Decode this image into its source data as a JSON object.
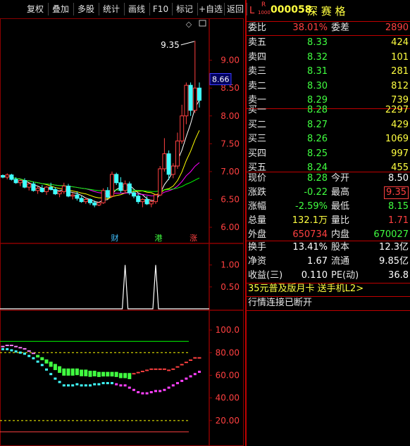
{
  "toolbar": {
    "buttons": [
      "复权",
      "叠加",
      "多股",
      "统计",
      "画线",
      "F10",
      "标记",
      "+自选",
      "返回"
    ]
  },
  "header": {
    "lr_top": "L",
    "lr_r": "R",
    "lr_sub": "1000",
    "code": "000058",
    "name": "深 赛 格"
  },
  "weibi": {
    "label1": "委比",
    "value1": "38.01%",
    "label2": "委差",
    "value2": "2890"
  },
  "sell": [
    {
      "label": "卖五",
      "price": "8.33",
      "vol": "424"
    },
    {
      "label": "卖四",
      "price": "8.32",
      "vol": "101"
    },
    {
      "label": "卖三",
      "price": "8.31",
      "vol": "281"
    },
    {
      "label": "卖二",
      "price": "8.30",
      "vol": "812"
    },
    {
      "label": "卖一",
      "price": "8.29",
      "vol": "739"
    }
  ],
  "buy": [
    {
      "label": "买一",
      "price": "8.28",
      "vol": "2297"
    },
    {
      "label": "买二",
      "price": "8.27",
      "vol": "429"
    },
    {
      "label": "买三",
      "price": "8.26",
      "vol": "1069"
    },
    {
      "label": "买四",
      "price": "8.25",
      "vol": "997"
    },
    {
      "label": "买五",
      "price": "8.24",
      "vol": "455"
    }
  ],
  "quote": [
    {
      "l1": "现价",
      "v1": "8.28",
      "c1": "grn",
      "l2": "今开",
      "v2": "8.50",
      "c2": "wht"
    },
    {
      "l1": "涨跌",
      "v1": "-0.22",
      "c1": "grn",
      "l2": "最高",
      "v2": "9.35",
      "c2": "red"
    },
    {
      "l1": "涨幅",
      "v1": "-2.59%",
      "c1": "grn",
      "l2": "最低",
      "v2": "8.15",
      "c2": "grn"
    },
    {
      "l1": "总量",
      "v1": "132.1万",
      "c1": "yel",
      "l2": "量比",
      "v2": "1.71",
      "c2": "red"
    },
    {
      "l1": "外盘",
      "v1": "650734",
      "c1": "red",
      "l2": "内盘",
      "v2": "670027",
      "c2": "grn"
    }
  ],
  "stats": [
    {
      "l1": "换手",
      "v1": "13.41%",
      "l2": "股本",
      "v2": "12.3亿"
    },
    {
      "l1": "净资",
      "v1": "1.67",
      "l2": "流通",
      "v2": "9.85亿"
    },
    {
      "l1": "收益(三)",
      "v1": "0.110",
      "l2": "PE(动)",
      "v2": "36.8"
    }
  ],
  "ad": "35元普及版月卡 送手机L2>",
  "status": "行情连接已断开",
  "colors": {
    "up": "#ff4040",
    "down": "#40ffff",
    "grid": "#8b0000",
    "ma1": "#ffffff",
    "ma2": "#ffff00",
    "ma3": "#ff00ff",
    "ma4": "#00ff00"
  },
  "chart_data": [
    {
      "type": "candlestick",
      "ylim": [
        5.9,
        9.5
      ],
      "y_ticks": [
        "9.00",
        "8.50",
        "8.00",
        "7.50",
        "7.00",
        "6.50",
        "6.00"
      ],
      "y_tick_values": [
        9.0,
        8.5,
        8.0,
        7.5,
        7.0,
        6.5,
        6.0
      ],
      "high_label": "9.35",
      "current_price": "8.66",
      "events": [
        {
          "label": "财",
          "color": "#40c0ff",
          "candle": 25
        },
        {
          "label": "港",
          "color": "#40ff40",
          "candle": 35
        },
        {
          "label": "涨",
          "color": "#ff4040",
          "candle": 43
        }
      ],
      "candles": [
        [
          6.93,
          6.95,
          6.88,
          6.9
        ],
        [
          6.9,
          6.97,
          6.86,
          6.94
        ],
        [
          6.94,
          6.96,
          6.84,
          6.86
        ],
        [
          6.86,
          6.9,
          6.78,
          6.8
        ],
        [
          6.8,
          6.86,
          6.74,
          6.84
        ],
        [
          6.84,
          6.88,
          6.7,
          6.72
        ],
        [
          6.72,
          6.8,
          6.66,
          6.78
        ],
        [
          6.78,
          6.82,
          6.64,
          6.66
        ],
        [
          6.66,
          6.74,
          6.6,
          6.7
        ],
        [
          6.7,
          6.76,
          6.62,
          6.64
        ],
        [
          6.64,
          6.74,
          6.58,
          6.72
        ],
        [
          6.72,
          6.8,
          6.66,
          6.68
        ],
        [
          6.68,
          6.72,
          6.58,
          6.6
        ],
        [
          6.6,
          6.66,
          6.54,
          6.64
        ],
        [
          6.64,
          6.8,
          6.6,
          6.74
        ],
        [
          6.74,
          6.78,
          6.54,
          6.56
        ],
        [
          6.56,
          6.62,
          6.5,
          6.58
        ],
        [
          6.58,
          6.64,
          6.48,
          6.52
        ],
        [
          6.52,
          6.56,
          6.44,
          6.46
        ],
        [
          6.46,
          6.54,
          6.42,
          6.5
        ],
        [
          6.5,
          6.52,
          6.4,
          6.44
        ],
        [
          6.44,
          6.48,
          6.36,
          6.4
        ],
        [
          6.4,
          6.46,
          6.38,
          6.44
        ],
        [
          6.44,
          6.7,
          6.42,
          6.66
        ],
        [
          6.66,
          6.72,
          6.52,
          6.54
        ],
        [
          6.56,
          7.0,
          6.54,
          6.95
        ],
        [
          6.95,
          6.98,
          6.76,
          6.8
        ],
        [
          6.8,
          6.9,
          6.62,
          6.66
        ],
        [
          6.66,
          6.84,
          6.6,
          6.78
        ],
        [
          6.78,
          6.82,
          6.58,
          6.62
        ],
        [
          6.62,
          6.66,
          6.52,
          6.56
        ],
        [
          6.56,
          6.6,
          6.42,
          6.46
        ],
        [
          6.46,
          6.52,
          6.36,
          6.5
        ],
        [
          6.5,
          6.56,
          6.4,
          6.42
        ],
        [
          6.42,
          6.5,
          6.36,
          6.46
        ],
        [
          6.46,
          6.6,
          6.42,
          6.58
        ],
        [
          6.58,
          7.1,
          6.56,
          7.05
        ],
        [
          7.05,
          7.6,
          7.0,
          7.32
        ],
        [
          7.32,
          7.38,
          6.85,
          6.95
        ],
        [
          6.95,
          7.15,
          6.88,
          7.1
        ],
        [
          7.1,
          7.7,
          7.05,
          7.55
        ],
        [
          7.55,
          8.2,
          7.5,
          8.0
        ],
        [
          8.0,
          8.6,
          7.85,
          8.55
        ],
        [
          8.55,
          8.6,
          8.0,
          8.1
        ],
        [
          8.1,
          9.35,
          8.05,
          8.5
        ],
        [
          8.5,
          8.6,
          8.15,
          8.28
        ]
      ]
    },
    {
      "type": "line",
      "ylim": [
        0,
        1.3
      ],
      "y_ticks": [
        "1.00",
        "0.50"
      ],
      "y_tick_values": [
        1.0,
        0.5
      ],
      "spikes": [
        28,
        35
      ],
      "spike_value": 1.0
    },
    {
      "type": "scatter",
      "ylim": [
        0,
        115
      ],
      "y_ticks": [
        "100.0",
        "80.00",
        "60.00",
        "40.00",
        "20.00"
      ],
      "y_tick_values": [
        100,
        80,
        60,
        40,
        20
      ],
      "ref_lines": [
        90,
        80,
        20,
        10
      ],
      "upper": [
        86,
        87,
        87,
        86,
        85,
        84,
        82,
        80,
        78,
        76,
        74,
        72,
        70,
        68,
        66,
        66,
        66,
        66,
        65,
        65,
        64,
        64,
        63,
        63,
        63,
        63,
        63,
        62,
        62,
        62,
        62,
        63,
        64,
        65,
        66,
        66,
        66,
        66,
        65,
        66,
        68,
        70,
        72,
        74,
        76,
        76
      ],
      "lower": [
        84,
        84,
        83,
        82,
        81,
        80,
        78,
        76,
        73,
        70,
        66,
        62,
        58,
        55,
        52,
        52,
        52,
        53,
        52,
        52,
        52,
        53,
        53,
        54,
        54,
        54,
        53,
        52,
        52,
        50,
        48,
        46,
        45,
        45,
        46,
        47,
        47,
        48,
        50,
        52,
        54,
        56,
        58,
        60,
        62,
        64
      ]
    }
  ]
}
